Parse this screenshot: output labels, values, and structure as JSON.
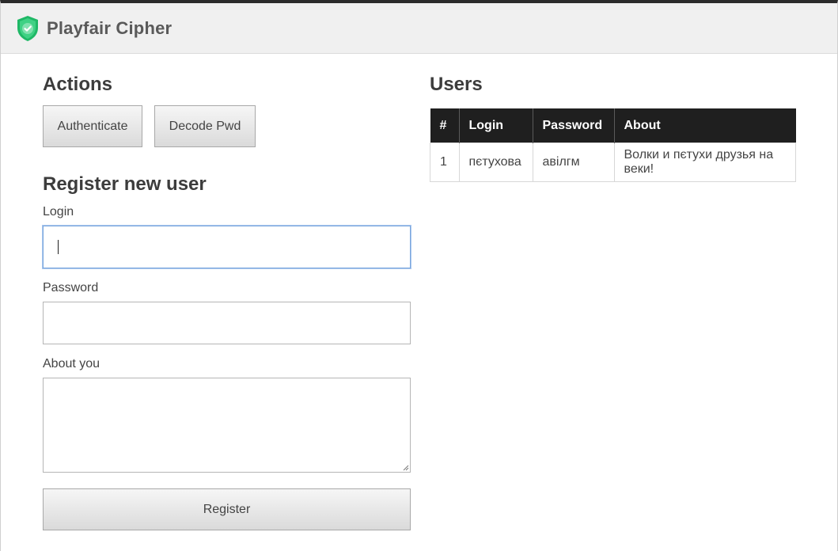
{
  "header": {
    "title": "Playfair Cipher",
    "logo_icon": "shield-check-icon",
    "brand_color": "#1fb866"
  },
  "actions": {
    "heading": "Actions",
    "authenticate_label": "Authenticate",
    "decode_label": "Decode Pwd"
  },
  "register": {
    "heading": "Register new user",
    "login_label": "Login",
    "login_value": "",
    "password_label": "Password",
    "password_value": "",
    "about_label": "About you",
    "about_value": "",
    "submit_label": "Register"
  },
  "users": {
    "heading": "Users",
    "columns": [
      "#",
      "Login",
      "Password",
      "About"
    ],
    "rows": [
      {
        "num": "1",
        "login": "пєтухова",
        "password": "авілгм",
        "about": "Волки и пєтухи друзья на веки!"
      }
    ]
  }
}
